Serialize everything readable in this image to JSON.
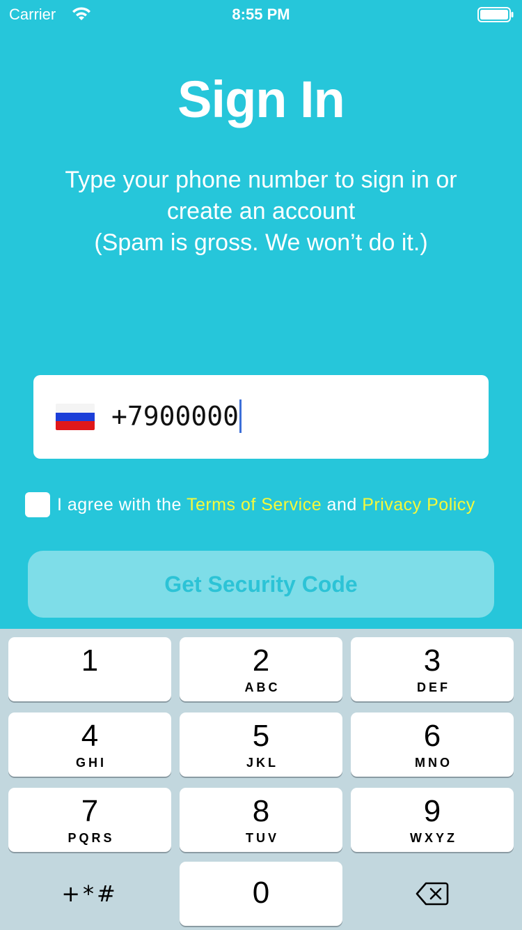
{
  "status_bar": {
    "carrier": "Carrier",
    "time": "8:55 PM",
    "wifi_icon": "wifi-icon",
    "battery_icon": "battery-icon"
  },
  "header": {
    "title": "Sign In",
    "subtitle_lines": [
      "Type your phone number to sign in or",
      "create an account",
      "(Spam is gross. We won’t do it.)"
    ]
  },
  "phone": {
    "flag_icon": "russia-flag-icon",
    "value": "+7900000"
  },
  "agreement": {
    "checked": false,
    "prefix": "I agree with the ",
    "terms_link": "Terms of Service",
    "middle": " and ",
    "privacy_link": "Privacy Policy"
  },
  "get_code_button": {
    "label": "Get Security Code",
    "enabled": false
  },
  "keyboard": {
    "keys": [
      {
        "digit": "1",
        "letters": ""
      },
      {
        "digit": "2",
        "letters": "ABC"
      },
      {
        "digit": "3",
        "letters": "DEF"
      },
      {
        "digit": "4",
        "letters": "GHI"
      },
      {
        "digit": "5",
        "letters": "JKL"
      },
      {
        "digit": "6",
        "letters": "MNO"
      },
      {
        "digit": "7",
        "letters": "PQRS"
      },
      {
        "digit": "8",
        "letters": "TUV"
      },
      {
        "digit": "9",
        "letters": "WXYZ"
      }
    ],
    "symbols": "+*#",
    "zero": "0",
    "delete_icon": "backspace-icon"
  },
  "colors": {
    "background": "#26c6da",
    "link": "#f6f93a",
    "button_bg": "#7edde8",
    "button_text": "#2cc3d6",
    "keyboard_bg": "#c2d7de",
    "cursor": "#3d6fd8"
  }
}
